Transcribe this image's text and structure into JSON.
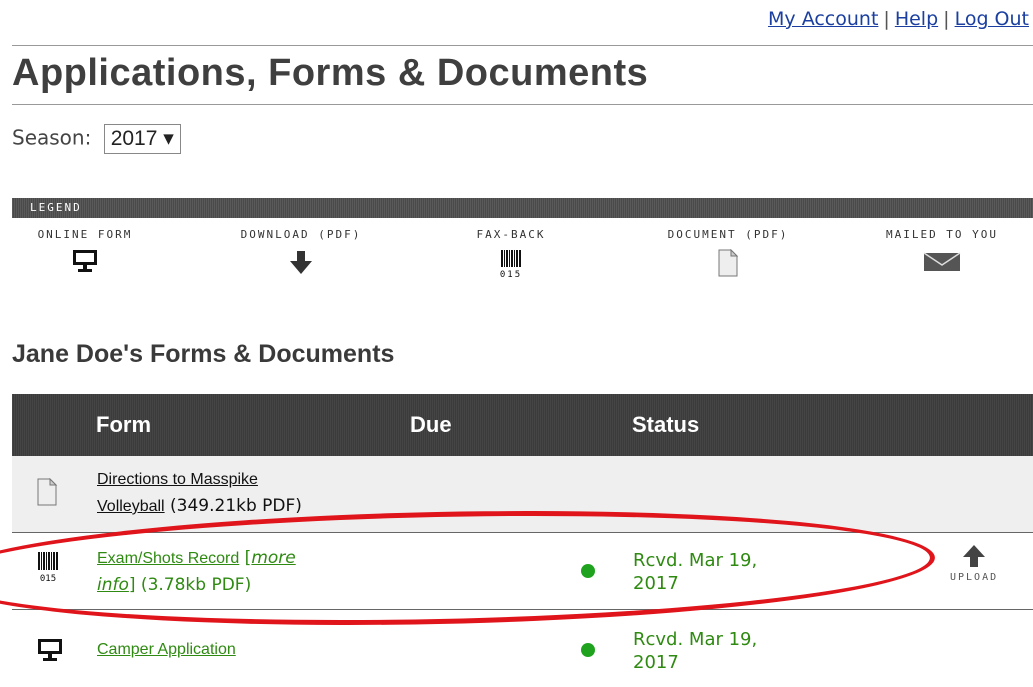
{
  "header": {
    "links": [
      "My Account",
      "Help",
      "Log Out"
    ],
    "separator": "|"
  },
  "page_title": "Applications, Forms & Documents",
  "season": {
    "label": "Season:",
    "value": "2017 ▾"
  },
  "legend": {
    "title": "LEGEND",
    "items": [
      {
        "label": "ONLINE FORM",
        "icon": "computer-icon"
      },
      {
        "label": "DOWNLOAD (PDF)",
        "icon": "download-arrow-icon"
      },
      {
        "label": "FAX-BACK",
        "icon": "barcode-icon"
      },
      {
        "label": "DOCUMENT (PDF)",
        "icon": "document-icon"
      },
      {
        "label": "MAILED TO YOU",
        "icon": "envelope-icon"
      }
    ],
    "barcode_text": "015"
  },
  "section_title": "Jane Doe's Forms & Documents",
  "table": {
    "columns": [
      "Form",
      "Due",
      "Status"
    ],
    "rows": [
      {
        "icon": "document-icon",
        "link": "Directions to Masspike Volleyball",
        "link_line1": "Directions to Masspike",
        "link_line2": "Volleyball",
        "suffix": " (349.21kb PDF)"
      },
      {
        "icon": "barcode-icon",
        "link": "Exam/Shots Record",
        "open_bracket": " [",
        "more_info_line1": "more",
        "more_info_line2": "info",
        "close_bracket": "]",
        "suffix": " (3.78kb PDF)",
        "status_line1": "Rcvd. Mar 19,",
        "status_line2": "2017",
        "action": "UPLOAD"
      },
      {
        "icon": "computer-icon",
        "link": "Camper Application",
        "status_line1": "Rcvd. Mar 19,",
        "status_line2": "2017"
      }
    ]
  },
  "colors": {
    "link": "#1a3fa0",
    "status_green": "#2f8a12",
    "dot_green": "#1fa31f",
    "annotation_red": "#e0141b"
  }
}
